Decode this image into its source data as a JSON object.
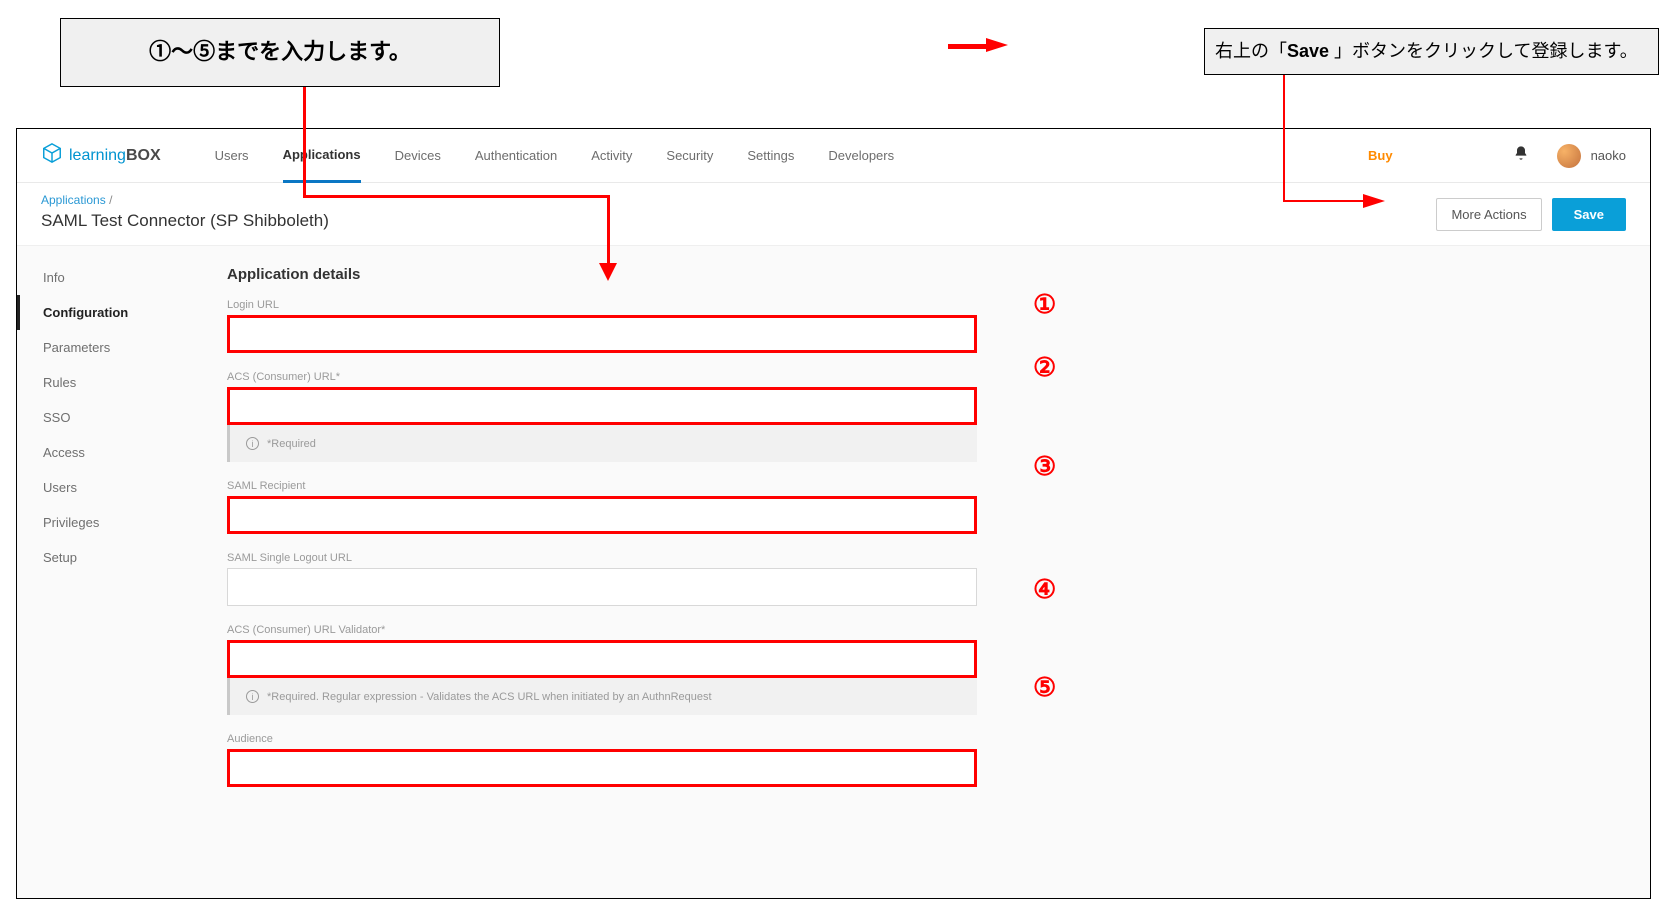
{
  "callouts": {
    "left_text": "①〜⑤までを入力します。",
    "right_prefix": "右上の「",
    "right_bold": "Save ",
    "right_suffix": "」ボタンをクリックして登録します。"
  },
  "nav": {
    "brand_prefix": "learning",
    "brand_suffix": "BOX",
    "items": [
      "Users",
      "Applications",
      "Devices",
      "Authentication",
      "Activity",
      "Security",
      "Settings",
      "Developers"
    ],
    "active_index": 1,
    "buy": "Buy",
    "username": "naoko"
  },
  "breadcrumb": {
    "parent": "Applications",
    "sep": "/"
  },
  "page_title": "SAML Test Connector (SP Shibboleth)",
  "actions": {
    "more": "More Actions",
    "save": "Save"
  },
  "sidenav": {
    "items": [
      "Info",
      "Configuration",
      "Parameters",
      "Rules",
      "SSO",
      "Access",
      "Users",
      "Privileges",
      "Setup"
    ],
    "active_index": 1
  },
  "section_heading": "Application details",
  "fields": {
    "login_url": {
      "label": "Login URL",
      "num": "①"
    },
    "acs_url": {
      "label": "ACS (Consumer) URL*",
      "num": "②",
      "hint": "*Required"
    },
    "saml_recipient": {
      "label": "SAML Recipient",
      "num": "③"
    },
    "slo_url": {
      "label": "SAML Single Logout URL"
    },
    "acs_validator": {
      "label": "ACS (Consumer) URL Validator*",
      "num": "④",
      "hint": "*Required. Regular expression - Validates the ACS URL when initiated by an AuthnRequest"
    },
    "audience": {
      "label": "Audience",
      "num": "⑤"
    }
  }
}
